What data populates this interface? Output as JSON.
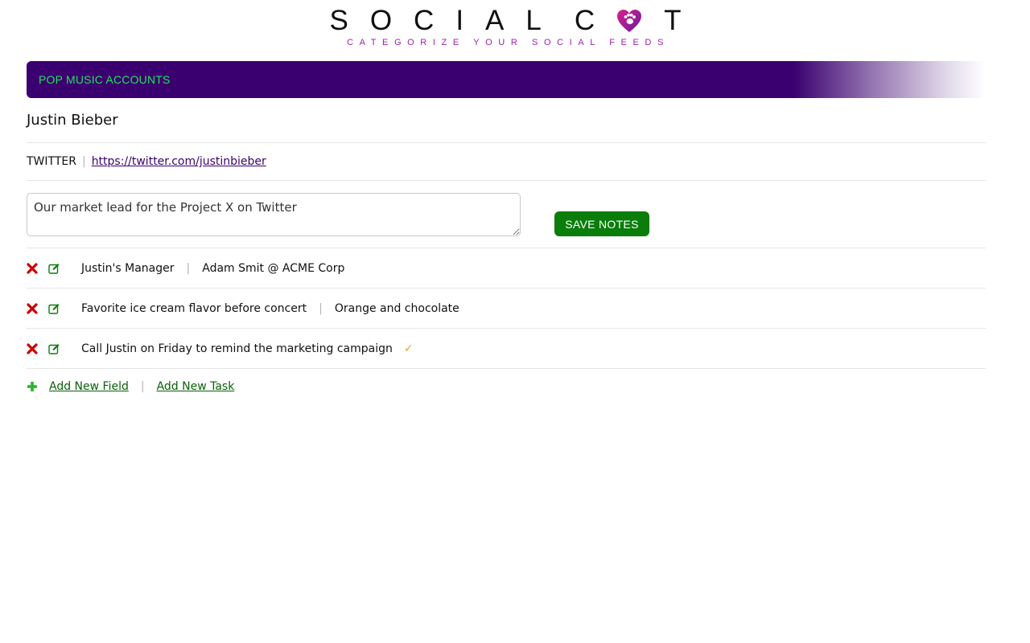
{
  "logo": {
    "word_left": "SOCIAL",
    "word_right_start": "C",
    "word_right_end": "T",
    "tagline": "CATEGORIZE YOUR SOCIAL FEEDS",
    "heart_icon": "heart-paw-icon",
    "colors": {
      "heart": "#c81e8c",
      "heart_dark": "#7a1a9a",
      "tagline": "#a020b0"
    }
  },
  "category": {
    "title": "POP MUSIC ACCOUNTS",
    "bar_color": "#3b006f",
    "title_color": "#22e35a"
  },
  "account": {
    "name": "Justin Bieber",
    "network": "TWITTER",
    "separator": "|",
    "url": "https://twitter.com/justinbieber"
  },
  "notes": {
    "value": "Our market lead for the Project X on Twitter",
    "save_label": "SAVE NOTES",
    "save_color": "#0a7d0a"
  },
  "fields": [
    {
      "key": "Justin's Manager",
      "separator": "|",
      "value": "Adam Smit @ ACME Corp",
      "is_task": false
    },
    {
      "key": "Favorite ice cream flavor before concert",
      "separator": "|",
      "value": "Orange and chocolate",
      "is_task": false
    },
    {
      "key": "Call Justin on Friday to remind the marketing campaign",
      "separator": "",
      "value": "",
      "is_task": true,
      "check": "✓"
    }
  ],
  "actions": {
    "add_field": "Add New Field",
    "separator": "|",
    "add_task": "Add New Task",
    "icons": {
      "delete": "delete-x-icon",
      "edit": "edit-pencil-icon",
      "add": "plus-icon"
    },
    "colors": {
      "delete": "#cc0000",
      "edit": "#0a7d0a",
      "add": "#22b822",
      "check": "#f0a030"
    }
  }
}
